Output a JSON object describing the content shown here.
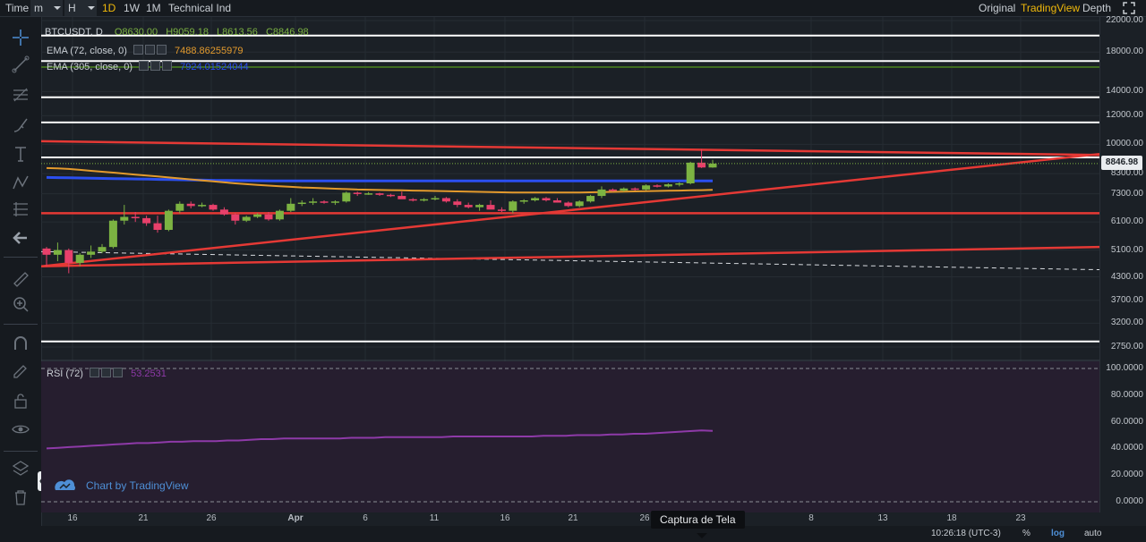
{
  "toolbar": {
    "time_label": "Time",
    "minute": "m",
    "hour": "H",
    "day": "1D",
    "week": "1W",
    "month": "1M",
    "indicators": "Technical Ind",
    "view_original": "Original",
    "view_tradingview": "TradingView",
    "view_depth": "Depth"
  },
  "legend": {
    "symbol": "BTCUSDT, D",
    "ohlc": {
      "open": "O8630.00",
      "high": "H9059.18",
      "low": "L8613.56",
      "close": "C8846.98"
    },
    "ema72_name": "EMA (72, close, 0)",
    "ema72_value": "7488.86255979",
    "ema305_name": "EMA (305, close, 0)",
    "ema305_value": "7924.01524044",
    "rsi_name": "RSI (72)",
    "rsi_value": "53.2531"
  },
  "price_axis": [
    "22000.00",
    "18000.00",
    "14000.00",
    "12000.00",
    "10000.00",
    "8300.00",
    "7300.00",
    "6100.00",
    "5100.00",
    "4300.00",
    "3700.00",
    "3200.00",
    "2750.00"
  ],
  "current_price": "8846.98",
  "rsi_axis": [
    "100.0000",
    "80.0000",
    "60.0000",
    "40.0000",
    "20.0000",
    "0.0000"
  ],
  "x_axis": [
    "16",
    "21",
    "26",
    "Apr",
    "6",
    "11",
    "16",
    "21",
    "26",
    "8",
    "13",
    "18",
    "23"
  ],
  "footer": {
    "clock": "10:26:18 (UTC-3)",
    "percent": "%",
    "log": "log",
    "auto": "auto"
  },
  "tooltip": "Captura de Tela",
  "brand": "Chart by TradingView",
  "colors": {
    "up": "#7cb342",
    "down": "#e8406b",
    "ema72": "#e39a2d",
    "ema305": "#2b4ff0",
    "trendline": "#e53935",
    "level": "#ffffff",
    "rsi": "#8e3aa8",
    "accent": "#f0b90b"
  },
  "chart_data": {
    "type": "candlestick",
    "scale": "log",
    "x_labels": [
      "16",
      "21",
      "26",
      "Apr",
      "6",
      "11",
      "16",
      "21",
      "26",
      "8",
      "13",
      "18",
      "23"
    ],
    "candles": [
      {
        "o": 5150,
        "h": 5200,
        "l": 4600,
        "c": 4950
      },
      {
        "o": 4950,
        "h": 5350,
        "l": 4750,
        "c": 5100
      },
      {
        "o": 5100,
        "h": 5150,
        "l": 4400,
        "c": 4700
      },
      {
        "o": 4700,
        "h": 5000,
        "l": 4600,
        "c": 4950
      },
      {
        "o": 4950,
        "h": 5250,
        "l": 4850,
        "c": 5050
      },
      {
        "o": 5050,
        "h": 5300,
        "l": 5000,
        "c": 5200
      },
      {
        "o": 5200,
        "h": 6200,
        "l": 5150,
        "c": 6150
      },
      {
        "o": 6150,
        "h": 6800,
        "l": 6000,
        "c": 6300
      },
      {
        "o": 6300,
        "h": 6500,
        "l": 6100,
        "c": 6250
      },
      {
        "o": 6250,
        "h": 6350,
        "l": 5950,
        "c": 6050
      },
      {
        "o": 6050,
        "h": 6350,
        "l": 5700,
        "c": 5800
      },
      {
        "o": 5800,
        "h": 6600,
        "l": 5750,
        "c": 6550
      },
      {
        "o": 6550,
        "h": 6950,
        "l": 6450,
        "c": 6850
      },
      {
        "o": 6850,
        "h": 6950,
        "l": 6650,
        "c": 6750
      },
      {
        "o": 6750,
        "h": 6900,
        "l": 6700,
        "c": 6800
      },
      {
        "o": 6800,
        "h": 6850,
        "l": 6550,
        "c": 6600
      },
      {
        "o": 6600,
        "h": 6700,
        "l": 6350,
        "c": 6400
      },
      {
        "o": 6400,
        "h": 6450,
        "l": 6000,
        "c": 6150
      },
      {
        "o": 6150,
        "h": 6350,
        "l": 6100,
        "c": 6300
      },
      {
        "o": 6300,
        "h": 6450,
        "l": 6250,
        "c": 6400
      },
      {
        "o": 6400,
        "h": 6500,
        "l": 6150,
        "c": 6200
      },
      {
        "o": 6200,
        "h": 6600,
        "l": 6150,
        "c": 6550
      },
      {
        "o": 6550,
        "h": 7100,
        "l": 6500,
        "c": 6850
      },
      {
        "o": 6850,
        "h": 7000,
        "l": 6750,
        "c": 6900
      },
      {
        "o": 6900,
        "h": 7100,
        "l": 6800,
        "c": 6950
      },
      {
        "o": 6950,
        "h": 7000,
        "l": 6850,
        "c": 6900
      },
      {
        "o": 6900,
        "h": 7000,
        "l": 6800,
        "c": 6950
      },
      {
        "o": 6950,
        "h": 7400,
        "l": 6900,
        "c": 7350
      },
      {
        "o": 7350,
        "h": 7400,
        "l": 7200,
        "c": 7300
      },
      {
        "o": 7300,
        "h": 7380,
        "l": 7250,
        "c": 7320
      },
      {
        "o": 7320,
        "h": 7350,
        "l": 7200,
        "c": 7250
      },
      {
        "o": 7250,
        "h": 7300,
        "l": 7150,
        "c": 7200
      },
      {
        "o": 7200,
        "h": 7400,
        "l": 7100,
        "c": 7050
      },
      {
        "o": 7050,
        "h": 7100,
        "l": 6950,
        "c": 7000
      },
      {
        "o": 7000,
        "h": 7100,
        "l": 6950,
        "c": 7050
      },
      {
        "o": 7050,
        "h": 7200,
        "l": 7000,
        "c": 7100
      },
      {
        "o": 7100,
        "h": 7150,
        "l": 6900,
        "c": 6950
      },
      {
        "o": 6950,
        "h": 7050,
        "l": 6700,
        "c": 6800
      },
      {
        "o": 6800,
        "h": 6900,
        "l": 6650,
        "c": 6700
      },
      {
        "o": 6700,
        "h": 6850,
        "l": 6550,
        "c": 6800
      },
      {
        "o": 6800,
        "h": 7000,
        "l": 6650,
        "c": 6600
      },
      {
        "o": 6600,
        "h": 6700,
        "l": 6500,
        "c": 6550
      },
      {
        "o": 6550,
        "h": 7000,
        "l": 6450,
        "c": 6950
      },
      {
        "o": 6950,
        "h": 7050,
        "l": 6850,
        "c": 7000
      },
      {
        "o": 7000,
        "h": 7150,
        "l": 6950,
        "c": 7100
      },
      {
        "o": 7100,
        "h": 7150,
        "l": 6950,
        "c": 7000
      },
      {
        "o": 7000,
        "h": 7100,
        "l": 6900,
        "c": 6900
      },
      {
        "o": 6900,
        "h": 6950,
        "l": 6700,
        "c": 6750
      },
      {
        "o": 6750,
        "h": 7000,
        "l": 6700,
        "c": 6950
      },
      {
        "o": 6950,
        "h": 7250,
        "l": 6900,
        "c": 7200
      },
      {
        "o": 7200,
        "h": 7650,
        "l": 7100,
        "c": 7500
      },
      {
        "o": 7500,
        "h": 7550,
        "l": 7400,
        "c": 7450
      },
      {
        "o": 7450,
        "h": 7600,
        "l": 7400,
        "c": 7550
      },
      {
        "o": 7550,
        "h": 7600,
        "l": 7450,
        "c": 7500
      },
      {
        "o": 7500,
        "h": 7750,
        "l": 7450,
        "c": 7700
      },
      {
        "o": 7700,
        "h": 7750,
        "l": 7600,
        "c": 7650
      },
      {
        "o": 7650,
        "h": 7800,
        "l": 7600,
        "c": 7750
      },
      {
        "o": 7750,
        "h": 7850,
        "l": 7650,
        "c": 7800
      },
      {
        "o": 7800,
        "h": 8950,
        "l": 7750,
        "c": 8900
      },
      {
        "o": 8900,
        "h": 9700,
        "l": 8600,
        "c": 8630
      },
      {
        "o": 8630,
        "h": 9059.18,
        "l": 8613.56,
        "c": 8846.98
      }
    ],
    "ema72": [
      8600,
      8580,
      8550,
      8500,
      8450,
      8400,
      8350,
      8300,
      8250,
      8200,
      8150,
      8100,
      8050,
      8000,
      7950,
      7900,
      7850,
      7800,
      7760,
      7720,
      7690,
      7660,
      7630,
      7600,
      7580,
      7560,
      7540,
      7520,
      7500,
      7490,
      7480,
      7470,
      7460,
      7450,
      7440,
      7430,
      7420,
      7410,
      7400,
      7390,
      7380,
      7370,
      7360,
      7360,
      7360,
      7360,
      7360,
      7360,
      7360,
      7370,
      7380,
      7390,
      7400,
      7410,
      7420,
      7430,
      7440,
      7450,
      7460,
      7470,
      7488.86
    ],
    "ema305": [
      8100,
      8090,
      8080,
      8070,
      8060,
      8050,
      8040,
      8030,
      8020,
      8010,
      8000,
      7990,
      7980,
      7970,
      7960,
      7950,
      7945,
      7940,
      7935,
      7930,
      7925,
      7920,
      7920,
      7920,
      7920,
      7920,
      7920,
      7920,
      7920,
      7920,
      7920,
      7920,
      7920,
      7920,
      7920,
      7920,
      7920,
      7920,
      7920,
      7920,
      7920,
      7920,
      7920,
      7920,
      7920,
      7920,
      7920,
      7920,
      7920,
      7920,
      7920,
      7920,
      7920,
      7920,
      7920,
      7920,
      7920,
      7920,
      7920,
      7924.02
    ],
    "rsi": [
      40,
      40.5,
      41,
      41.5,
      42,
      42.5,
      43,
      43.5,
      44,
      44,
      44.5,
      45,
      45,
      45.5,
      45.5,
      45.5,
      46,
      46,
      46.5,
      47,
      47,
      47.5,
      47.5,
      47.5,
      47.5,
      47.5,
      47.5,
      48,
      48,
      48,
      48.5,
      48.5,
      48.5,
      48.5,
      48.5,
      48.5,
      49,
      49,
      49,
      49,
      49,
      49,
      49,
      49,
      49.5,
      49.5,
      49.5,
      50,
      50,
      50,
      50.5,
      50.5,
      51,
      51,
      51.5,
      52,
      52.5,
      53,
      53.5,
      53.2531
    ],
    "horizontal_levels": [
      20000,
      17000,
      13500,
      11500,
      9200,
      2850
    ],
    "trendlines": [
      {
        "from": [
          0,
          10200
        ],
        "to": [
          1182,
          9350
        ]
      },
      {
        "from": [
          0,
          6450
        ],
        "to": [
          1182,
          6450
        ]
      },
      {
        "from": [
          0,
          4600
        ],
        "to": [
          1182,
          5200
        ]
      },
      {
        "from": [
          0,
          4600
        ],
        "to": [
          1182,
          9400
        ]
      }
    ],
    "dashed_level": {
      "from": [
        0,
        5050
      ],
      "to": [
        1182,
        4500
      ]
    }
  }
}
